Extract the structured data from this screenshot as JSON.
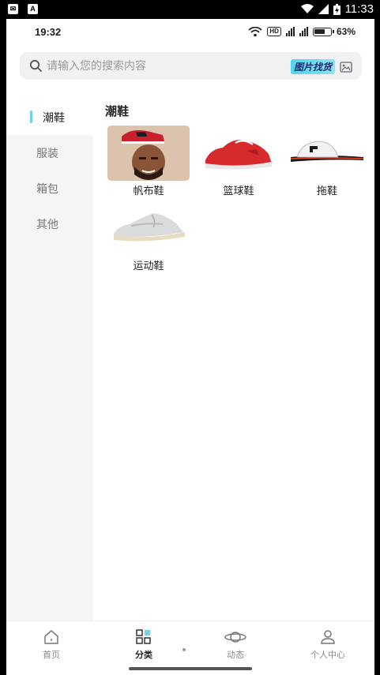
{
  "system_bar": {
    "time": "11:33"
  },
  "phone_status": {
    "time": "19:32",
    "hd": "HD",
    "battery": "63%"
  },
  "search": {
    "placeholder": "请输入您的搜索内容",
    "image_search_label": "图片找货"
  },
  "sidebar": {
    "items": [
      {
        "label": "潮鞋",
        "active": true
      },
      {
        "label": "服装",
        "active": false
      },
      {
        "label": "箱包",
        "active": false
      },
      {
        "label": "其他",
        "active": false
      }
    ]
  },
  "content": {
    "title": "潮鞋",
    "products": [
      {
        "name": "帆布鞋",
        "icon": "canvas-shoe-image"
      },
      {
        "name": "篮球鞋",
        "icon": "basketball-shoe-image"
      },
      {
        "name": "拖鞋",
        "icon": "slipper-image"
      },
      {
        "name": "运动鞋",
        "icon": "sneaker-image"
      }
    ]
  },
  "bottom_nav": {
    "tabs": [
      {
        "label": "首页",
        "icon": "home-icon",
        "active": false
      },
      {
        "label": "分类",
        "icon": "category-icon",
        "active": true
      },
      {
        "label": "动态",
        "icon": "planet-icon",
        "active": false
      },
      {
        "label": "个人中心",
        "icon": "user-icon",
        "active": false
      }
    ]
  },
  "colors": {
    "accent": "#6fd3e8",
    "sidebar_bg": "#f5f5f5",
    "search_bg": "#f1f1f3"
  }
}
